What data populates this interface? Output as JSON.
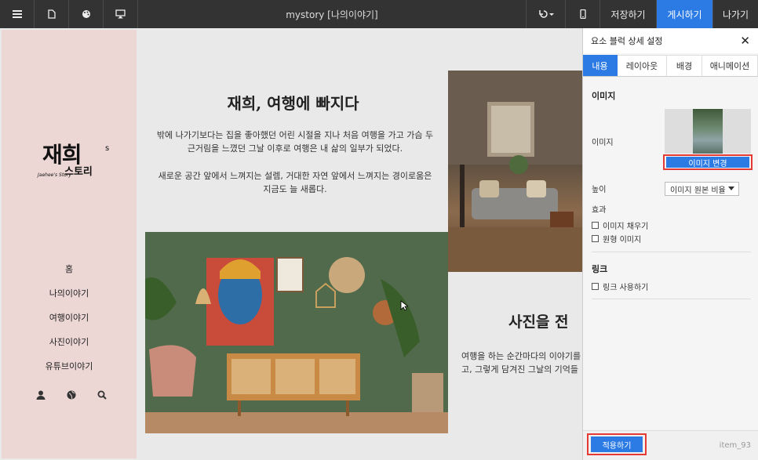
{
  "topbar": {
    "menu_icon": "hamburger-icon",
    "page_icon": "document-icon",
    "theme_icon": "palette-icon",
    "desktop_icon": "monitor-icon",
    "title": "mystory [나의이야기]",
    "undo_icon": "undo-icon",
    "mobile_icon": "mobile-icon",
    "save_label": "저장하기",
    "publish_label": "게시하기",
    "exit_label": "나가기"
  },
  "site": {
    "logo_main": "재희",
    "logo_s": "s",
    "logo_sub": "스토리",
    "logo_script": "Jaehee's Story",
    "nav": [
      "홈",
      "나의이야기",
      "여행이야기",
      "사진이야기",
      "유튜브이야기"
    ],
    "nav_icons": [
      "user-icon",
      "globe-icon",
      "search-icon"
    ],
    "section1": {
      "title": "재희, 여행에 빠지다",
      "p1_line1": "밖에 나가기보다는 집을 좋아했던 어린 시절을 지나 처음 여행을 가고 가슴 두",
      "p1_line2": "근거림을 느꼈던 그날 이후로 여행은 내 삶의 일부가 되었다.",
      "p2_line1": "새로운 공간 앞에서 느껴지는 설렘, 거대한 자연 앞에서 느껴지는 경이로움은",
      "p2_line2": "지금도 늘 새롭다."
    },
    "section2": {
      "title": "사진을 전",
      "p_line1": "여행을 하는 순간마다의 이야기를",
      "p_line2": "고, 그렇게 담겨진 그날의 기억들"
    }
  },
  "panel": {
    "title": "요소 블럭 상세 설정",
    "close_icon": "close-icon",
    "tabs": [
      "내용",
      "레이아웃",
      "배경",
      "애니메이션"
    ],
    "active_tab": "내용",
    "image_section": "이미지",
    "image_label": "이미지",
    "change_image": "이미지 변경",
    "height_label": "높이",
    "height_value": "이미지 원본 비율",
    "effect_label": "효과",
    "effect_fill": "이미지 채우기",
    "effect_circle": "원형 이미지",
    "link_section": "링크",
    "use_link": "링크 사용하기",
    "apply": "적용하기",
    "item_id": "item_93"
  },
  "colors": {
    "topbar": "#333333",
    "accent": "#2c7be5",
    "highlight": "#e53935",
    "left_panel": "#ecd7d5",
    "canvas": "#e9e9e9"
  }
}
